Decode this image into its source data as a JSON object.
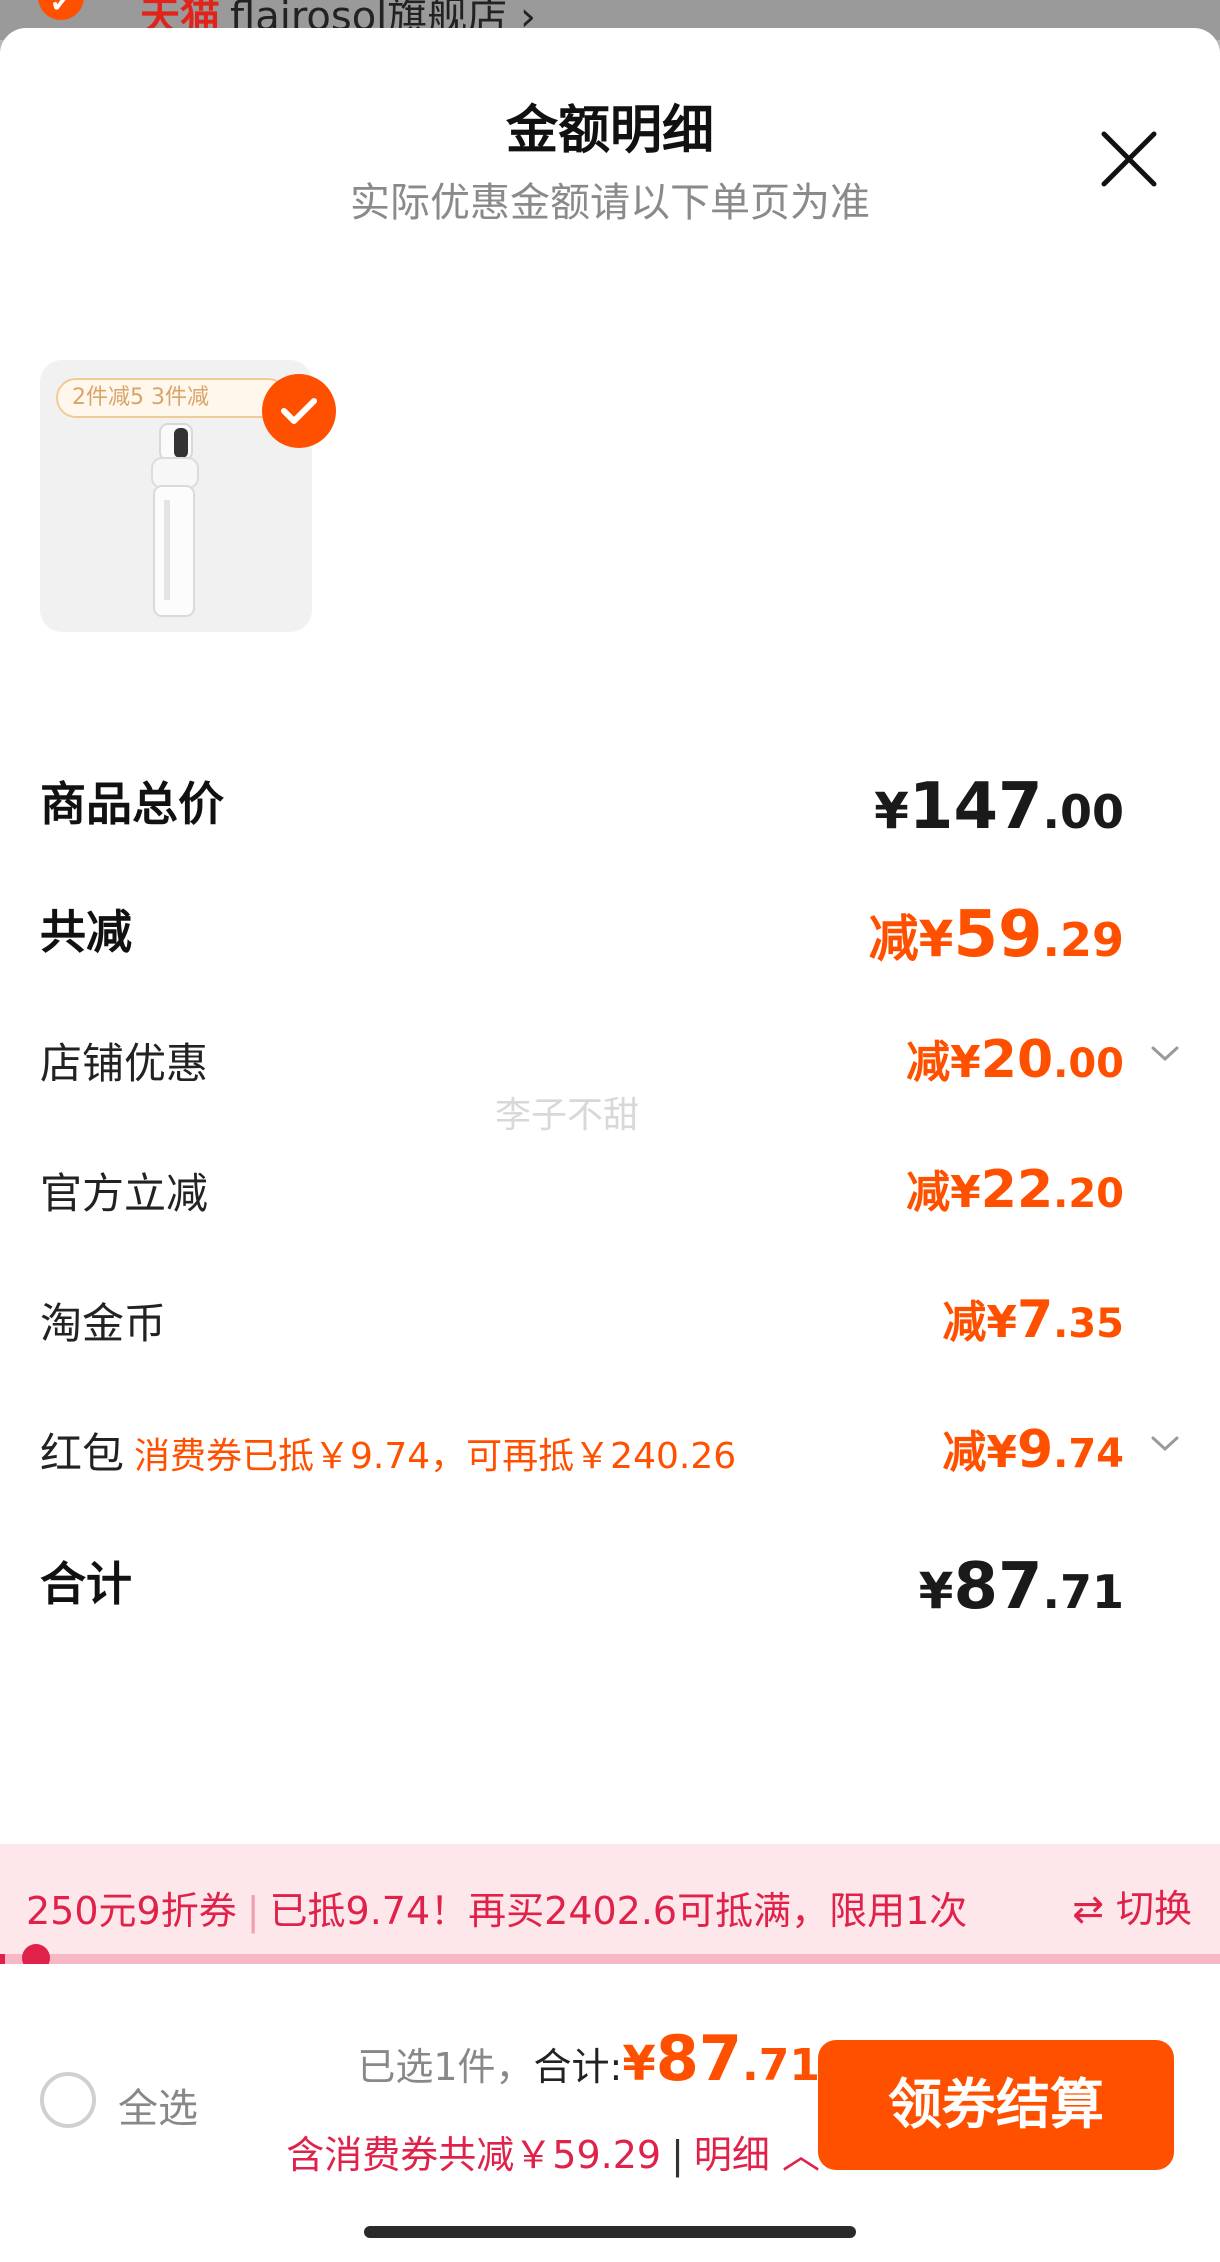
{
  "background_store": {
    "tmall_label": "天猫",
    "store_name": "flairosol旗舰店 ›"
  },
  "sheet": {
    "title": "金额明细",
    "subtitle": "实际优惠金额请以下单页为准"
  },
  "product": {
    "promo_tag": "2件减5  3件减",
    "icon": "spray-bottle-icon"
  },
  "rows": {
    "total_price": {
      "label": "商品总价",
      "yen": "¥",
      "int": "147",
      "dec": ".00"
    },
    "total_discount": {
      "label": "共减",
      "prefix": "减",
      "yen": "¥",
      "int": "59",
      "dec": ".29"
    },
    "store_discount": {
      "label": "店铺优惠",
      "prefix": "减",
      "yen": "¥",
      "int": "20",
      "dec": ".00"
    },
    "official_discount": {
      "label": "官方立减",
      "prefix": "减",
      "yen": "¥",
      "int": "22",
      "dec": ".20"
    },
    "taojinbi": {
      "label": "淘金币",
      "prefix": "减",
      "yen": "¥",
      "int": "7",
      "dec": ".35"
    },
    "red_packet": {
      "label": "红包",
      "note": "消费券已抵￥9.74，可再抵￥240.26",
      "prefix": "减",
      "yen": "¥",
      "int": "9",
      "dec": ".74"
    },
    "sum": {
      "label": "合计",
      "yen": "¥",
      "int": "87",
      "dec": ".71"
    }
  },
  "watermark": "李子不甜",
  "coupon_bar": {
    "coupon": "250元9折券",
    "info": "已抵9.74！再买2402.6可抵满，限用1次",
    "switch": "切换",
    "progress": 0.0039
  },
  "footer": {
    "select_all": "全选",
    "selected": "已选1件，",
    "total_label": "合计:",
    "yen": "¥",
    "int": "87",
    "dec": ".71",
    "saved": "含消费券共减￥59.29",
    "detail": "明细",
    "checkout": "领券结算"
  },
  "colors": {
    "accent": "#ff5000",
    "coupon_red": "#e0224a"
  }
}
